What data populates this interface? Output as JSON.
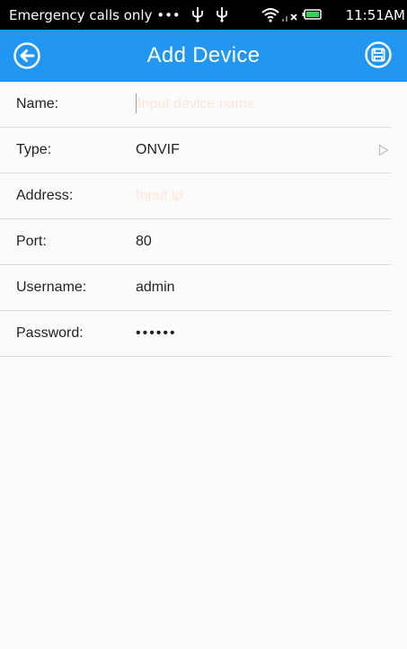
{
  "status_bar": {
    "carrier_text": "Emergency calls only •••",
    "time": "11:51AM",
    "icons": [
      "usb-icon",
      "usb-icon",
      "wifi-icon",
      "no-signal-icon",
      "battery-icon"
    ]
  },
  "app_bar": {
    "title": "Add Device",
    "back_icon": "back-arrow-icon",
    "save_icon": "save-icon",
    "color": "#2196f3"
  },
  "form": {
    "name": {
      "label": "Name:",
      "value": "",
      "placeholder": "Input device name"
    },
    "type": {
      "label": "Type:",
      "value": "ONVIF"
    },
    "address": {
      "label": "Address:",
      "value": "",
      "placeholder": "Input ip"
    },
    "port": {
      "label": "Port:",
      "value": "80"
    },
    "username": {
      "label": "Username:",
      "value": "admin"
    },
    "password": {
      "label": "Password:",
      "value": "••••••"
    }
  }
}
